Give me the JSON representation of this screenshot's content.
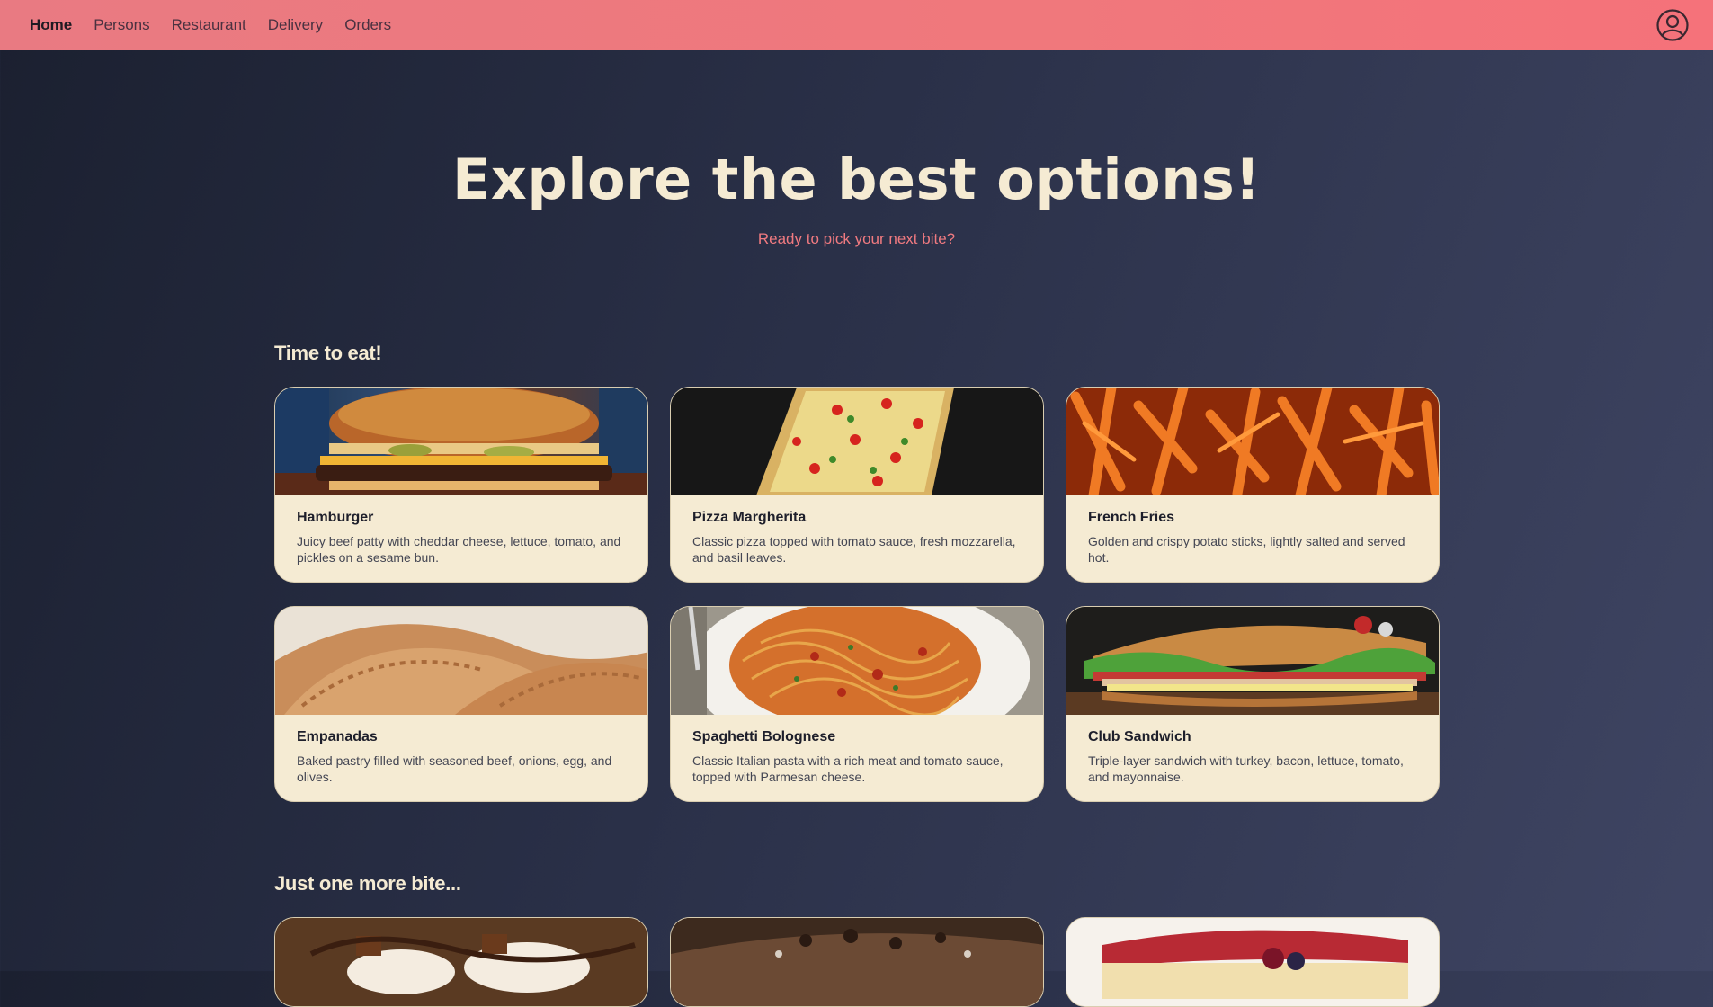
{
  "nav": {
    "items": [
      {
        "label": "Home",
        "active": true
      },
      {
        "label": "Persons",
        "active": false
      },
      {
        "label": "Restaurant",
        "active": false
      },
      {
        "label": "Delivery",
        "active": false
      },
      {
        "label": "Orders",
        "active": false
      }
    ],
    "account_icon": "user-circle-icon"
  },
  "hero": {
    "title": "Explore the best options!",
    "subtitle": "Ready to pick your next bite?"
  },
  "sections": [
    {
      "title": "Time to eat!",
      "cards": [
        {
          "title": "Hamburger",
          "description": "Juicy beef patty with cheddar cheese, lettuce, tomato, and pickles on a sesame bun.",
          "image": "hamburger-photo"
        },
        {
          "title": "Pizza Margherita",
          "description": "Classic pizza topped with tomato sauce, fresh mozzarella, and basil leaves.",
          "image": "pizza-photo"
        },
        {
          "title": "French Fries",
          "description": "Golden and crispy potato sticks, lightly salted and served hot.",
          "image": "fries-photo"
        },
        {
          "title": "Empanadas",
          "description": "Baked pastry filled with seasoned beef, onions, egg, and olives.",
          "image": "empanadas-photo"
        },
        {
          "title": "Spaghetti Bolognese",
          "description": "Classic Italian pasta with a rich meat and tomato sauce, topped with Parmesan cheese.",
          "image": "spaghetti-photo"
        },
        {
          "title": "Club Sandwich",
          "description": "Triple-layer sandwich with turkey, bacon, lettuce, tomato, and mayonnaise.",
          "image": "sandwich-photo"
        }
      ]
    },
    {
      "title": "Just one more bite...",
      "cards": [
        {
          "image": "sundae-photo"
        },
        {
          "image": "brownie-photo"
        },
        {
          "image": "cheesecake-photo"
        }
      ]
    }
  ],
  "colors": {
    "nav_bg": "#f0787c",
    "page_bg": "#2a3048",
    "card_bg": "#f5ebd3",
    "accent": "#f07a80",
    "heading": "#f5ebd3"
  }
}
